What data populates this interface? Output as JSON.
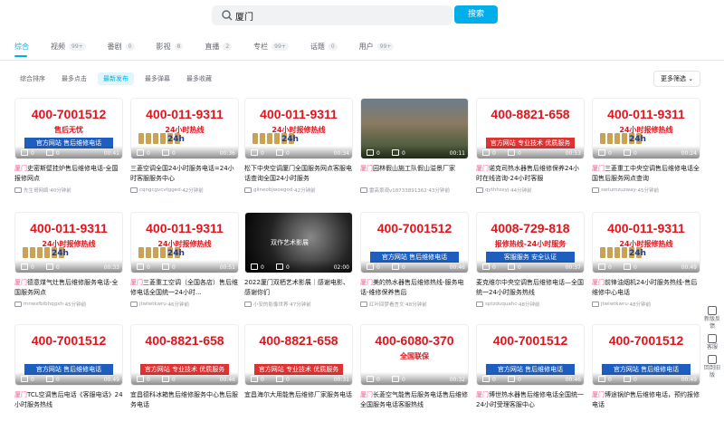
{
  "search": {
    "query": "厦门",
    "button_label": "搜索"
  },
  "tabs": [
    {
      "label": "综合",
      "count": ""
    },
    {
      "label": "视频",
      "count": "99+"
    },
    {
      "label": "番剧",
      "count": "0"
    },
    {
      "label": "影视",
      "count": "8"
    },
    {
      "label": "直播",
      "count": "2"
    },
    {
      "label": "专栏",
      "count": "99+"
    },
    {
      "label": "话题",
      "count": "0"
    },
    {
      "label": "用户",
      "count": "99+"
    }
  ],
  "filters": [
    "综合排序",
    "最多点击",
    "最新发布",
    "最多弹幕",
    "最多收藏"
  ],
  "more_filter": "更多筛选",
  "side": [
    "新版反馈",
    "客服",
    "回到旧版"
  ],
  "highlight_color": "#f25d8e",
  "cards": [
    {
      "thumb": {
        "phone": "400-7001512",
        "sub": "售后无忧",
        "tag": "官方网站 售后维修电话",
        "style": "a"
      },
      "plays": "0",
      "dm": "0",
      "dur": "00:41",
      "hl": "厦门",
      "title": "史密斯壁挂炉售后维修电话-全国报修网点",
      "author": "先生哥网络",
      "time": "40分钟前"
    },
    {
      "thumb": {
        "phone": "400-011-9311",
        "sub": "24小时热线",
        "tag": "",
        "style": "b"
      },
      "plays": "0",
      "dm": "0",
      "dur": "00:36",
      "hl": "",
      "pre": "三菱空调",
      "title": "全国24小时服务电话=24小时客服服务中心",
      "author": "cqngcgvcvtgged",
      "time": "42分钟前"
    },
    {
      "thumb": {
        "phone": "400-011-9311",
        "sub": "24小时报修热线",
        "tag": "",
        "style": "c"
      },
      "plays": "0",
      "dm": "0",
      "dur": "00:34",
      "hl": "",
      "pre": "松下中央空调",
      "title": "厦门全国服务网点客服电话查询全国24小时服务",
      "author": "glineobjwoegod",
      "time": "42分钟前"
    },
    {
      "thumb": {
        "phone": "",
        "sub": "",
        "tag": "",
        "style": "photo"
      },
      "plays": "0",
      "dm": "0",
      "dur": "00:11",
      "hl": "厦门",
      "title": "园林假山施工队假山溢景厂家",
      "author": "雷高景观v18733891362",
      "time": "43分钟前"
    },
    {
      "thumb": {
        "phone": "400-8821-658",
        "sub": "",
        "tag": "官方网站 专业技术 优质服务",
        "style": "d"
      },
      "plays": "0",
      "dm": "0",
      "dur": "00:53",
      "hl": "厦门",
      "title": "诺克司热水器售后维修保养24小时在线咨询-24小时客服",
      "author": "qythhssyj",
      "time": "44分钟前"
    },
    {
      "thumb": {
        "phone": "400-011-9311",
        "sub": "24小时报修热线",
        "tag": "",
        "style": "b"
      },
      "plays": "0",
      "dm": "0",
      "dur": "00:24",
      "hl": "厦门",
      "title": "三菱重工中央空调售后维修电话全国售后服务网点查询",
      "author": "swtumzuzway",
      "time": "45分钟前"
    },
    {
      "thumb": {
        "phone": "400-011-9311",
        "sub": "24小时报修热线",
        "tag": "",
        "style": "e"
      },
      "plays": "0",
      "dm": "0",
      "dur": "00:33",
      "hl": "厦门",
      "title": "德意煤气灶售后维修服务电话-全国服务网点",
      "author": "mnwsfblbhqgxh",
      "time": "45分钟前"
    },
    {
      "thumb": {
        "phone": "400-011-9311",
        "sub": "24小时报修热线",
        "tag": "",
        "style": "e"
      },
      "plays": "0",
      "dm": "0",
      "dur": "00:51",
      "hl": "厦门",
      "title": "三菱重工空调（全国各店）售后维修电话全国统一24小时...",
      "author": "jtwlwtkwru",
      "time": "46分钟前"
    },
    {
      "thumb": {
        "phone": "",
        "sub": "双作艺术影展",
        "tag": "",
        "style": "dark"
      },
      "plays": "0",
      "dm": "0",
      "dur": "02:00",
      "hl": "",
      "pre": "2022",
      "title": "厦门双栖艺术影展｜感谢电影、感谢你们",
      "author": "小安的影像世界",
      "time": "47分钟前"
    },
    {
      "thumb": {
        "phone": "400-7001512",
        "sub": "",
        "tag": "官方网站 售后维修电话",
        "style": "f"
      },
      "plays": "0",
      "dm": "0",
      "dur": "00:46",
      "hl": "厦门",
      "title": "美的热水器售后维修热线-服务电话-维修保养售后",
      "author": "红叶回梦看言文",
      "time": "48分钟前"
    },
    {
      "thumb": {
        "phone": "4008-729-818",
        "sub": "报修热线-24小时服务",
        "tag": "客服服务 安全认证",
        "style": "g"
      },
      "plays": "0",
      "dm": "0",
      "dur": "00:37",
      "hl": "",
      "pre": "麦克维尔中央空调售后维修电话—全国统一24小时服务热线",
      "title": "",
      "author": "sptzduquahc",
      "time": "48分钟前"
    },
    {
      "thumb": {
        "phone": "400-011-9311",
        "sub": "24小时报修热线",
        "tag": "",
        "style": "e"
      },
      "plays": "0",
      "dm": "0",
      "dur": "00:49",
      "hl": "厦门",
      "title": "前锋油烟机24小时服务热线-售后维修中心电话",
      "author": "jtwlwtkwru",
      "time": "48分钟前"
    },
    {
      "thumb": {
        "phone": "400-7001512",
        "sub": "",
        "tag": "官方网站 售后维修电话",
        "style": "f"
      },
      "plays": "0",
      "dm": "0",
      "dur": "00:49",
      "hl": "厦门",
      "title": "TCL空调售后电话《客服电话》24小时服务热线",
      "author": "",
      "time": ""
    },
    {
      "thumb": {
        "phone": "400-8821-658",
        "sub": "",
        "tag": "官方网站 专业技术 优质服务",
        "style": "d"
      },
      "plays": "0",
      "dm": "0",
      "dur": "00:46",
      "hl": "",
      "pre": "宜昌德科冰箱售后维修服务中心售后服务电话",
      "title": "",
      "author": "",
      "time": ""
    },
    {
      "thumb": {
        "phone": "400-8821-658",
        "sub": "",
        "tag": "官方网站 专业技术 优质服务",
        "style": "d"
      },
      "plays": "0",
      "dm": "0",
      "dur": "00:31",
      "hl": "",
      "pre": "宜昌海尔大用能售后维修厂家服务电话",
      "title": "",
      "author": "",
      "time": ""
    },
    {
      "thumb": {
        "phone": "400-6080-370",
        "sub": "全国联保",
        "tag": "",
        "style": "h"
      },
      "plays": "0",
      "dm": "0",
      "dur": "00:32",
      "hl": "厦门",
      "title": "长菱空气能售后服务电话售后维修全国服务电话客服热线",
      "author": "",
      "time": ""
    },
    {
      "thumb": {
        "phone": "400-7001512",
        "sub": "",
        "tag": "官方网站 售后维修电话",
        "style": "f"
      },
      "plays": "0",
      "dm": "0",
      "dur": "00:46",
      "hl": "厦门",
      "title": "博世热水器售后维修电话全国统一24小时受理客服中心",
      "author": "",
      "time": ""
    },
    {
      "thumb": {
        "phone": "400-7001512",
        "sub": "",
        "tag": "官方网站 售后维修电话",
        "style": "f"
      },
      "plays": "0",
      "dm": "0",
      "dur": "00:49",
      "hl": "厦门",
      "title": "博途锅炉售后维修电话，预约报修电话",
      "author": "",
      "time": ""
    }
  ]
}
